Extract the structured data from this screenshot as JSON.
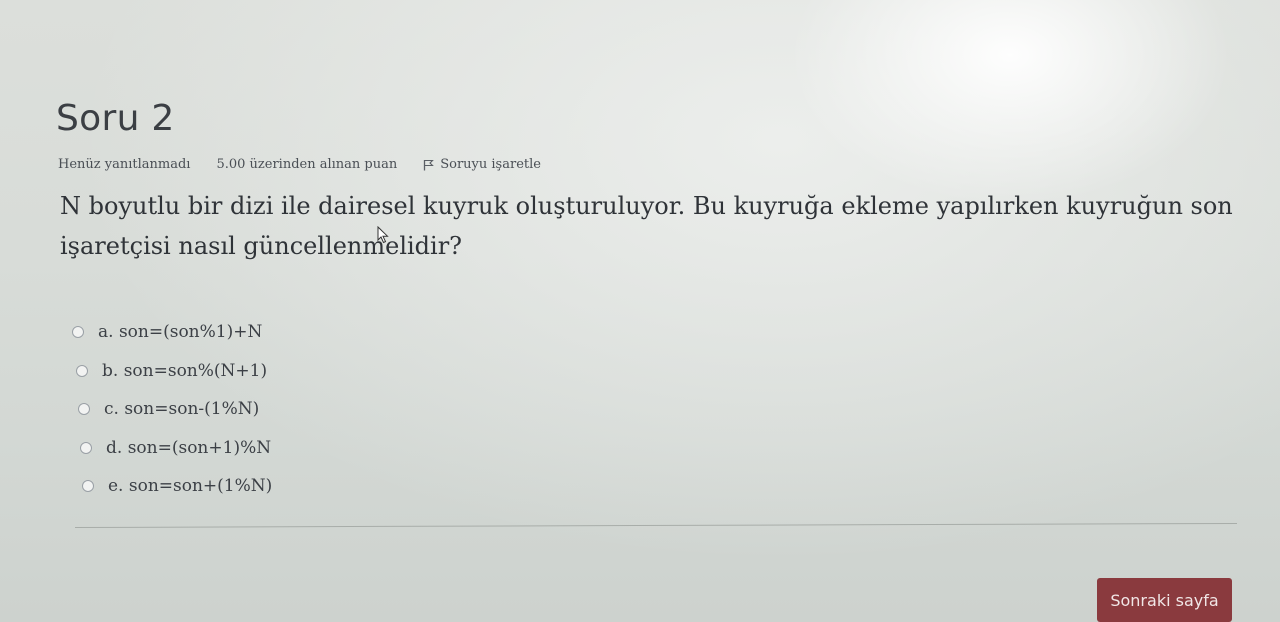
{
  "question": {
    "title": "Soru 2",
    "status": "Henüz yanıtlanmadı",
    "points": "5.00 üzerinden alınan puan",
    "flag_label": "Soruyu işaretle",
    "text": "N boyutlu bir dizi ile dairesel kuyruk oluşturuluyor. Bu kuyruğa ekleme yapılırken kuyruğun son işaretçisi nasıl güncellenmelidir?"
  },
  "answers": [
    {
      "label": "a. son=(son%1)+N"
    },
    {
      "label": "b. son=son%(N+1)"
    },
    {
      "label": "c. son=son-(1%N)"
    },
    {
      "label": "d. son=(son+1)%N"
    },
    {
      "label": "e. son=son+(1%N)"
    }
  ],
  "navigation": {
    "next_label": "Sonraki sayfa"
  },
  "colors": {
    "next_button": "#8a3a3e",
    "background": "#d8dcd8"
  }
}
